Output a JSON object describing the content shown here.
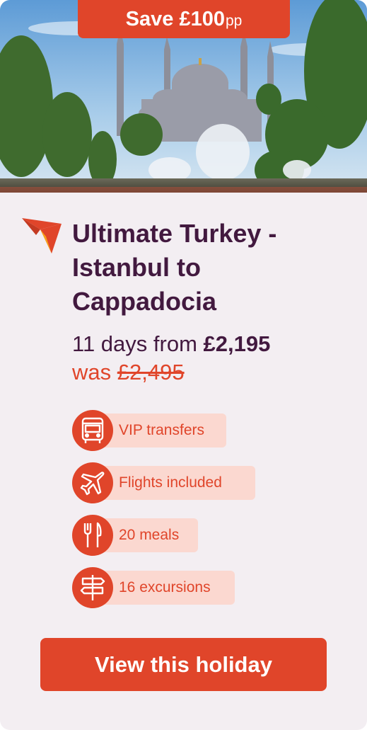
{
  "badge": {
    "save_text": "Save £100",
    "suffix": "pp"
  },
  "hero": {
    "image": "istanbul-blue-mosque-photo"
  },
  "brand": {
    "logo": "paper-plane-logo",
    "accent": "#e0452a",
    "text_color": "#42193f",
    "background": "#f3eef2"
  },
  "title": "Ultimate Turkey - Istanbul to Cappadocia",
  "price": {
    "prefix": "11 days from",
    "amount": "£2,195",
    "was_prefix": "was",
    "was_amount": "£2,495"
  },
  "features": [
    {
      "label": "VIP transfers",
      "icon": "bus-icon"
    },
    {
      "label": "Flights included",
      "icon": "plane-icon"
    },
    {
      "label": "20 meals",
      "icon": "cutlery-icon"
    },
    {
      "label": "16 excursions",
      "icon": "signpost-icon"
    }
  ],
  "cta": {
    "label": "View this holiday"
  }
}
